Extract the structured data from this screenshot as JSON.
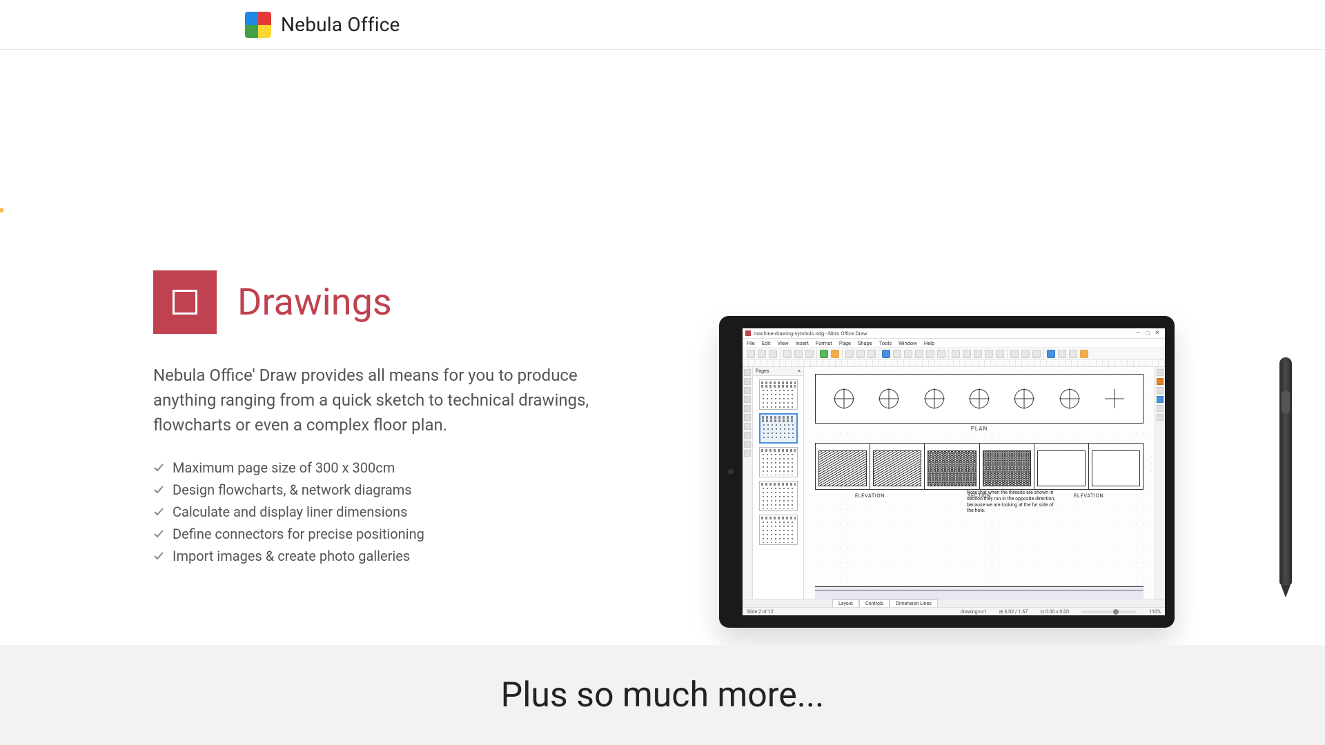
{
  "brand": {
    "name": "Nebula Office"
  },
  "section": {
    "title": "Drawings",
    "lead": "Nebula Office' Draw provides all means for you to produce anything ranging from a quick sketch to technical drawings, flowcharts or even a complex floor plan.",
    "features": [
      "Maximum page size of 300 x 300cm",
      "Design flowcharts, & network diagrams",
      "Calculate and display liner dimensions",
      "Define connectors for precise positioning",
      "Import images & create photo galleries"
    ]
  },
  "app_screenshot": {
    "window_title": "machine-drawing-symbols.odg - Nitro Office Draw",
    "menu": [
      "File",
      "Edit",
      "View",
      "Insert",
      "Format",
      "Page",
      "Shape",
      "Tools",
      "Window",
      "Help"
    ],
    "pages_label": "Pages",
    "plan_label": "PLAN",
    "elevation_labels": [
      "ELEVATION",
      "SECTION",
      "ELEVATION"
    ],
    "note_text": "Note that when the threads are shown in section they run in the opposite direction, because we are looking at the far side of the hole.",
    "tabs": [
      "Layout",
      "Controls",
      "Dimension Lines"
    ],
    "status": {
      "slide": "Slide 2 of 12",
      "style": "drawing-cc1",
      "coord1": "6.02 / 1.67",
      "coord2": "0.00 x 0.00",
      "zoom": "110%"
    }
  },
  "more": {
    "title": "Plus so much more..."
  }
}
